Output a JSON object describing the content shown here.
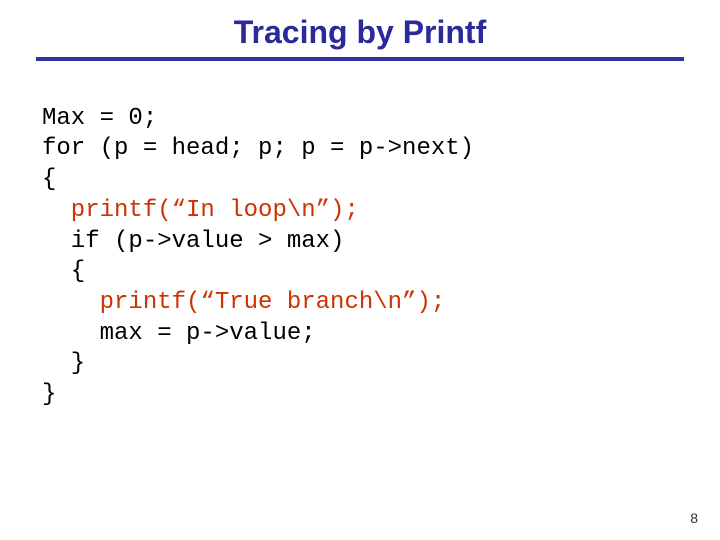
{
  "title": "Tracing by Printf",
  "code": {
    "l1": "Max = 0;",
    "l2": "for (p = head; p; p = p->next)",
    "l3": "{",
    "l4": "  printf(“In loop\\n”);",
    "l5": "  if (p->value > max)",
    "l6": "  {",
    "l7": "    printf(“True branch\\n”);",
    "l8": "    max = p->value;",
    "l9": "  }",
    "l10": "}"
  },
  "page_number": "8"
}
